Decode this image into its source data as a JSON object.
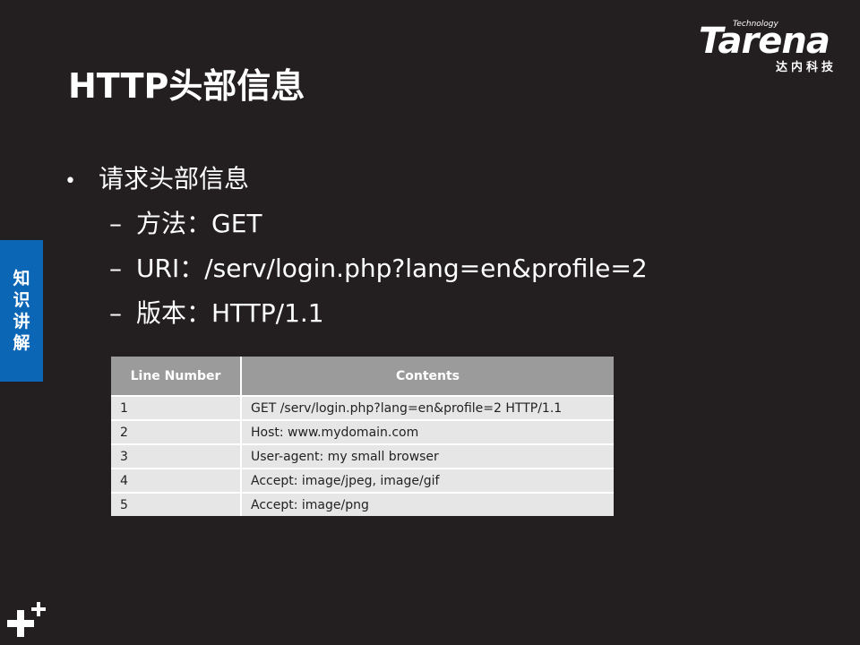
{
  "brand": {
    "tech": "Technology",
    "name": "Tarena",
    "cn": "达内科技"
  },
  "title": "HTTP头部信息",
  "bullet": "请求头部信息",
  "dash": "–",
  "bullet_dot": "•",
  "subitems": [
    "方法：GET",
    "URI：/serv/login.php?lang=en&profile=2",
    "版本：HTTP/1.1"
  ],
  "side_tab": [
    "知",
    "识",
    "讲",
    "解"
  ],
  "table": {
    "headers": [
      "Line Number",
      "Contents"
    ],
    "rows": [
      [
        "1",
        "GET /serv/login.php?lang=en&profile=2 HTTP/1.1"
      ],
      [
        "2",
        "Host: www.mydomain.com"
      ],
      [
        "3",
        "User-agent: my small browser"
      ],
      [
        "4",
        "Accept: image/jpeg, image/gif"
      ],
      [
        "5",
        "Accept: image/png"
      ]
    ]
  },
  "colors": {
    "background": "#231f20",
    "accent": "#0b66b6",
    "table_header": "#9b9b9b",
    "table_cell": "#e6e6e6"
  },
  "icons": {
    "corner": "plus-icon"
  }
}
